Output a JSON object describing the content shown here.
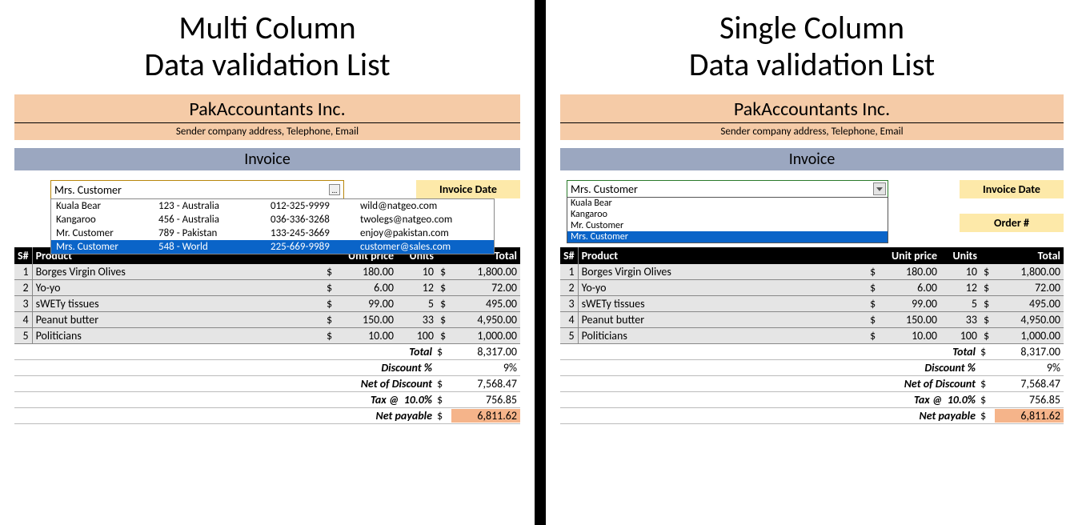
{
  "left": {
    "heading_l1": "Multi Column",
    "heading_l2": "Data validation List",
    "company": "PakAccountants Inc.",
    "company_sub": "Sender company address, Telephone, Email",
    "invoice_label": "Invoice",
    "combo_value": "Mrs. Customer",
    "combo_items": [
      {
        "name": "Kuala Bear",
        "addr": "123 - Australia",
        "phone": "012-325-9999",
        "email": "wild@natgeo.com",
        "selected": false
      },
      {
        "name": "Kangaroo",
        "addr": "456 - Australia",
        "phone": "036-336-3268",
        "email": "twolegs@natgeo.com",
        "selected": false
      },
      {
        "name": "Mr. Customer",
        "addr": "789 - Pakistan",
        "phone": "133-245-3669",
        "email": "enjoy@pakistan.com",
        "selected": false
      },
      {
        "name": "Mrs. Customer",
        "addr": "548 - World",
        "phone": "225-669-9989",
        "email": "customer@sales.com",
        "selected": true
      }
    ],
    "badge1": "Invoice Date"
  },
  "right": {
    "heading_l1": "Single Column",
    "heading_l2": "Data validation List",
    "company": "PakAccountants Inc.",
    "company_sub": "Sender company address, Telephone, Email",
    "invoice_label": "Invoice",
    "combo_value": "Mrs. Customer",
    "combo_items": [
      {
        "name": "Kuala Bear",
        "selected": false
      },
      {
        "name": "Kangaroo",
        "selected": false
      },
      {
        "name": "Mr. Customer",
        "selected": false
      },
      {
        "name": "Mrs. Customer",
        "selected": true
      }
    ],
    "badge1": "Invoice Date",
    "badge2": "Order #"
  },
  "table": {
    "headers": {
      "sn": "S#",
      "product": "Product",
      "unit_price": "Unit price",
      "units": "Units",
      "total": "Total"
    },
    "rows": [
      {
        "sn": "1",
        "product": "Borges Virgin Olives",
        "unit_price": "180.00",
        "units": "10",
        "total": "1,800.00"
      },
      {
        "sn": "2",
        "product": "Yo-yo",
        "unit_price": "6.00",
        "units": "12",
        "total": "72.00"
      },
      {
        "sn": "3",
        "product": "sWETy tissues",
        "unit_price": "99.00",
        "units": "5",
        "total": "495.00"
      },
      {
        "sn": "4",
        "product": "Peanut butter",
        "unit_price": "150.00",
        "units": "33",
        "total": "4,950.00"
      },
      {
        "sn": "5",
        "product": "Politicians",
        "unit_price": "10.00",
        "units": "100",
        "total": "1,000.00"
      }
    ]
  },
  "summary": {
    "total_label": "Total",
    "total_val": "8,317.00",
    "discount_label": "Discount %",
    "discount_val": "9%",
    "net_discount_label": "Net of Discount",
    "net_discount_val": "7,568.47",
    "tax_label": "Tax @",
    "tax_rate": "10.0%",
    "tax_val": "756.85",
    "net_payable_label": "Net payable",
    "net_payable_val": "6,811.62"
  },
  "currency": "$"
}
